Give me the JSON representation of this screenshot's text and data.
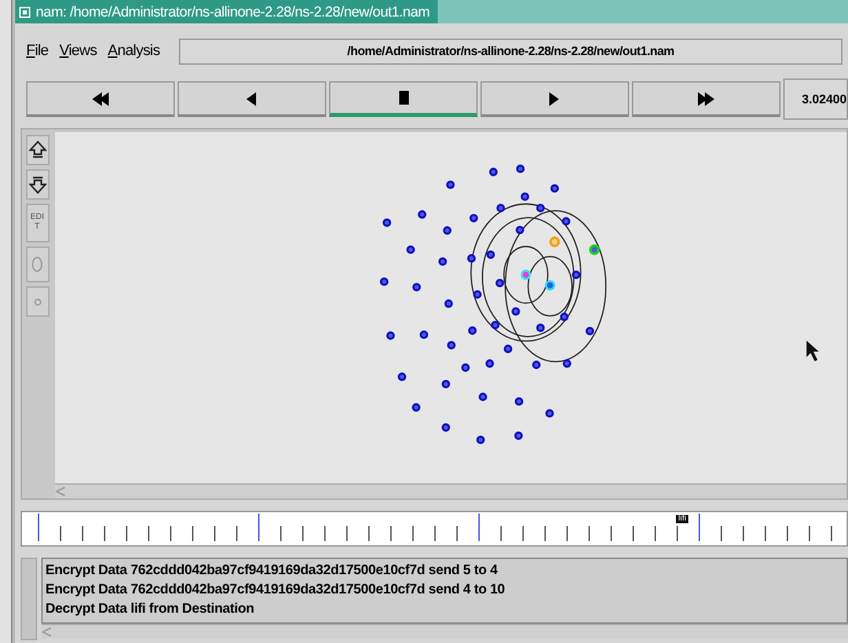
{
  "window": {
    "title": "nam: /home/Administrator/ns-allinone-2.28/ns-2.28/new/out1.nam"
  },
  "menu": [
    {
      "label": "File"
    },
    {
      "label": "Views"
    },
    {
      "label": "Analysis"
    }
  ],
  "file_path": "/home/Administrator/ns-allinone-2.28/ns-2.28/new/out1.nam",
  "playback": [
    {
      "kind": "rewind",
      "selected": false
    },
    {
      "kind": "back",
      "selected": false
    },
    {
      "kind": "stop",
      "selected": true
    },
    {
      "kind": "play",
      "selected": false
    },
    {
      "kind": "forward",
      "selected": false
    }
  ],
  "time": "3.02400",
  "tools": [
    {
      "kind": "zoom-in"
    },
    {
      "kind": "zoom-out"
    },
    {
      "kind": "edit",
      "label": "EDIT"
    },
    {
      "kind": "node",
      "disabled": true
    },
    {
      "kind": "link",
      "disabled": true
    }
  ],
  "timeline": {
    "marker": "lifi",
    "level": 0.79
  },
  "log": [
    "Encrypt Data 762cddd042ba97cf9419169da32d17500e10cf7d send 5 to 4",
    "Encrypt Data 762cddd042ba97cf9419169da32d17500e10cf7d send 4 to 10",
    "Decrypt Data lifi from Destination"
  ]
}
